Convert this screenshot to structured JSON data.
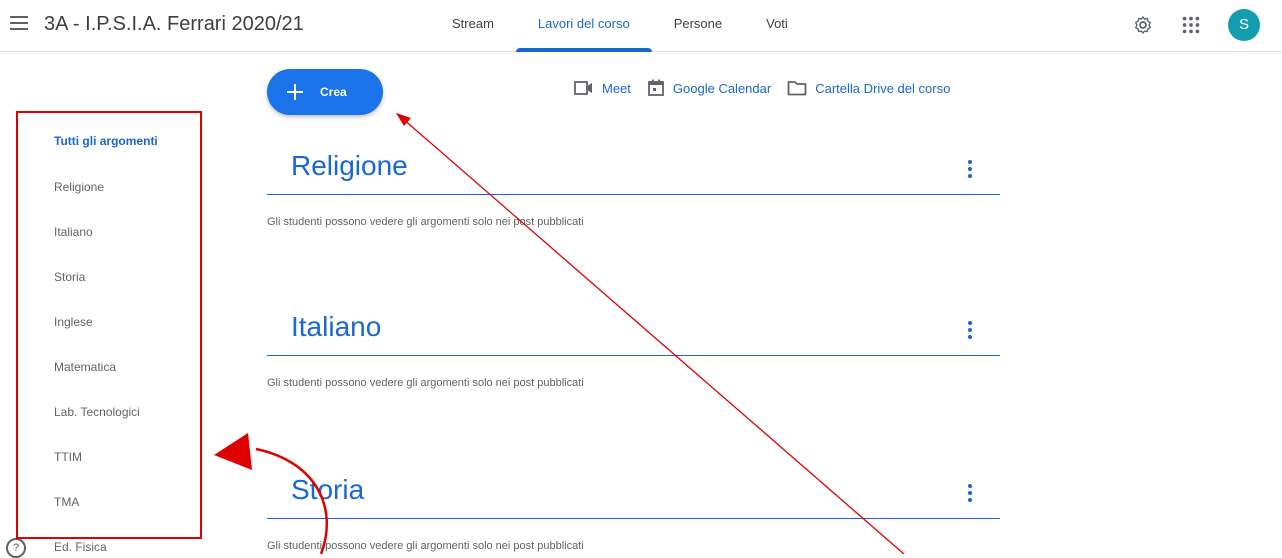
{
  "header": {
    "class_title": "3A - I.P.S.I.A. Ferrari 2020/21",
    "tabs": [
      {
        "label": "Stream"
      },
      {
        "label": "Lavori del corso"
      },
      {
        "label": "Persone"
      },
      {
        "label": "Voti"
      }
    ],
    "active_tab": "Lavori del corso",
    "avatar_letter": "S"
  },
  "toolbar": {
    "create_label": "Crea",
    "links": [
      {
        "label": "Meet",
        "icon": "meet-icon"
      },
      {
        "label": "Google Calendar",
        "icon": "calendar-icon"
      },
      {
        "label": "Cartella Drive del corso",
        "icon": "folder-icon"
      }
    ]
  },
  "sidebar": {
    "items": [
      {
        "label": "Tutti gli argomenti",
        "active": true
      },
      {
        "label": "Religione"
      },
      {
        "label": "Italiano"
      },
      {
        "label": "Storia"
      },
      {
        "label": "Inglese"
      },
      {
        "label": "Matematica"
      },
      {
        "label": "Lab. Tecnologici"
      },
      {
        "label": "TTIM"
      },
      {
        "label": "TMA"
      },
      {
        "label": "Ed. Fisica"
      }
    ]
  },
  "topics": [
    {
      "title": "Religione",
      "note": "Gli studenti possono vedere gli argomenti solo nei post pubblicati"
    },
    {
      "title": "Italiano",
      "note": "Gli studenti possono vedere gli argomenti solo nei post pubblicati"
    },
    {
      "title": "Storia",
      "note": "Gli studenti possono vedere gli argomenti solo nei post pubblicati"
    }
  ],
  "colors": {
    "accent": "#1967d2",
    "create_button": "#1a73e8",
    "avatar": "#129eaf",
    "annotation": "#e00000"
  }
}
